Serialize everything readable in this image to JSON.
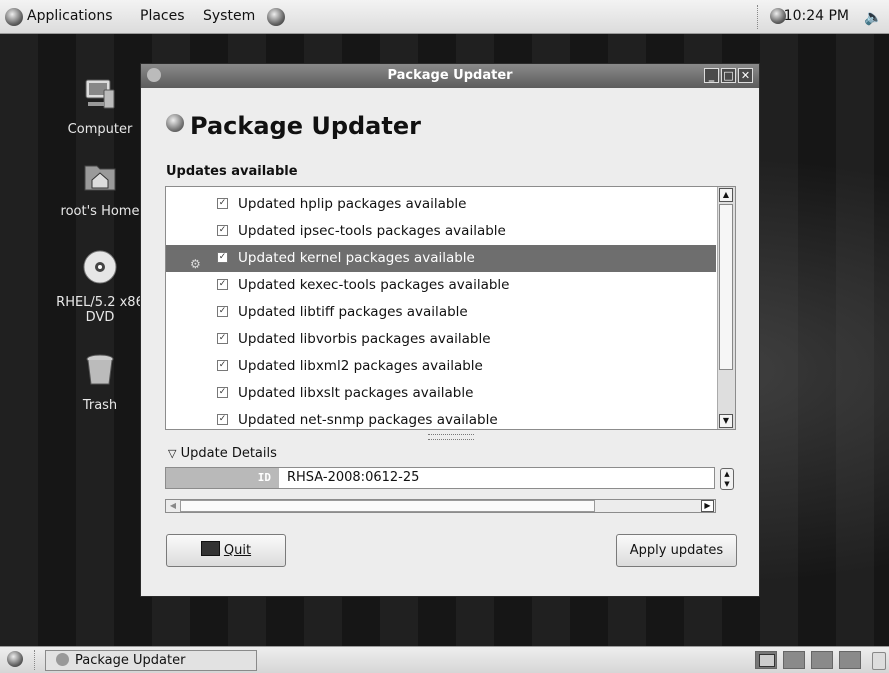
{
  "top_panel": {
    "menus": [
      "Applications",
      "Places",
      "System"
    ],
    "clock": "10:24 PM"
  },
  "desktop": {
    "icons": [
      {
        "label": "Computer"
      },
      {
        "label": "root's Home"
      },
      {
        "label": "RHEL/5.2 x86 DVD"
      },
      {
        "label": "Trash"
      }
    ]
  },
  "window": {
    "title": "Package Updater",
    "heading": "Package Updater",
    "updates_label": "Updates available",
    "updates": [
      {
        "label": "Updated hplip packages available",
        "checked": true
      },
      {
        "label": "Updated ipsec-tools packages available",
        "checked": true
      },
      {
        "label": "Updated kernel packages available",
        "checked": true,
        "selected": true
      },
      {
        "label": "Updated kexec-tools packages available",
        "checked": true
      },
      {
        "label": "Updated libtiff packages available",
        "checked": true
      },
      {
        "label": "Updated libvorbis packages available",
        "checked": true
      },
      {
        "label": "Updated libxml2 packages available",
        "checked": true
      },
      {
        "label": "Updated libxslt packages available",
        "checked": true
      },
      {
        "label": "Updated net-snmp packages available",
        "checked": true
      }
    ],
    "details": {
      "label": "Update Details",
      "id_key": "ID",
      "id_value": "RHSA-2008:0612-25"
    },
    "buttons": {
      "quit": "Quit",
      "apply": "Apply updates"
    }
  },
  "taskbar": {
    "window_button": "Package Updater"
  }
}
